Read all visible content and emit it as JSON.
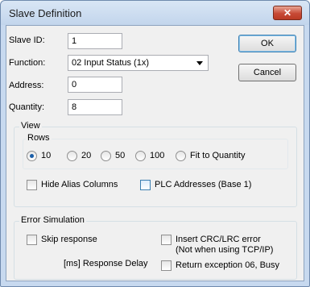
{
  "window": {
    "title": "Slave Definition",
    "close_glyph": "✕"
  },
  "form": {
    "slave_id_label": "Slave ID:",
    "slave_id_value": "1",
    "function_label": "Function:",
    "function_value": "02 Input Status (1x)",
    "address_label": "Address:",
    "address_value": "0",
    "quantity_label": "Quantity:",
    "quantity_value": "8"
  },
  "buttons": {
    "ok": "OK",
    "cancel": "Cancel"
  },
  "view": {
    "group_label": "View",
    "rows_label": "Rows",
    "rows_options": [
      "10",
      "20",
      "50",
      "100",
      "Fit to Quantity"
    ],
    "rows_selected": "10",
    "hide_alias_columns": {
      "label": "Hide Alias Columns",
      "checked": false
    },
    "plc_addresses": {
      "label": "PLC Addresses (Base 1)",
      "checked": false
    }
  },
  "error_simulation": {
    "group_label": "Error Simulation",
    "skip_response": {
      "label": "Skip response",
      "checked": false
    },
    "response_delay_label": "[ms] Response Delay",
    "insert_crc_line1": "Insert CRC/LRC error",
    "insert_crc_line2": "(Not when using TCP/IP)",
    "insert_crc_checked": false,
    "return_exception": {
      "label": "Return exception 06, Busy",
      "checked": false
    }
  },
  "colors": {
    "accent": "#1a5ea8",
    "close": "#c74a36",
    "title_bar": "#c7d9ef"
  }
}
